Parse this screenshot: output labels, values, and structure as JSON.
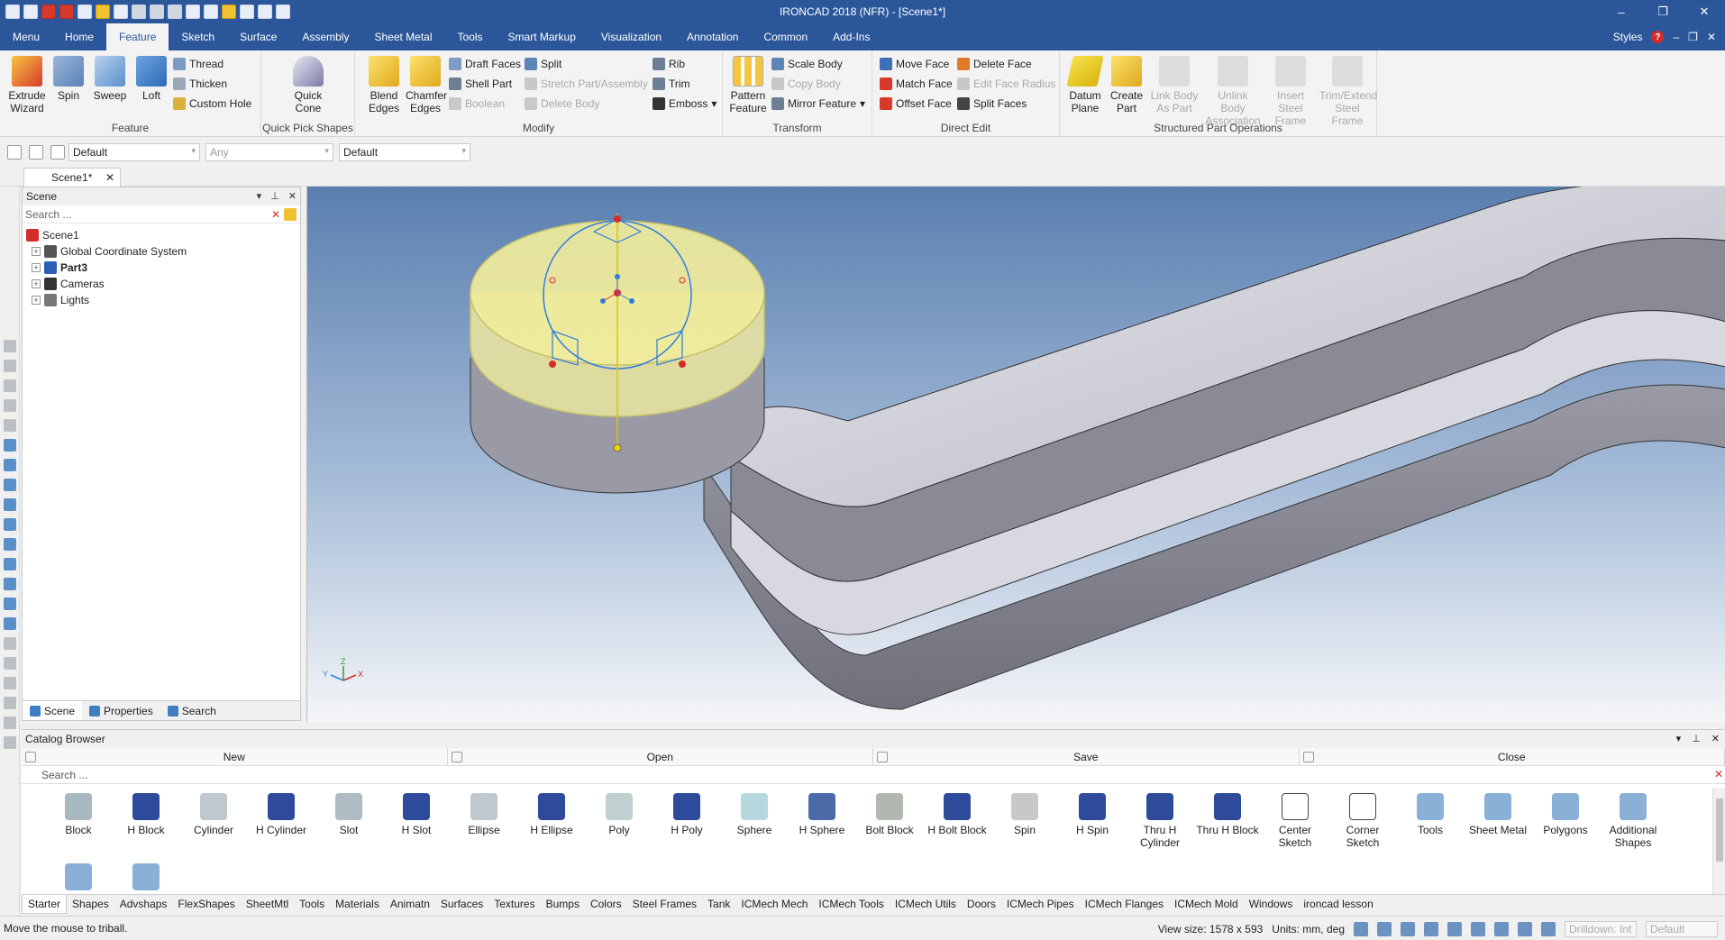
{
  "window": {
    "title": "IRONCAD 2018 (NFR) - [Scene1*]",
    "minimize": "–",
    "restore": "❐",
    "close": "✕"
  },
  "ribbon_tabs": [
    "Menu",
    "Home",
    "Feature",
    "Sketch",
    "Surface",
    "Assembly",
    "Sheet Metal",
    "Tools",
    "Smart Markup",
    "Visualization",
    "Annotation",
    "Common",
    "Add-Ins"
  ],
  "ribbon_right": {
    "styles": "Styles",
    "help": "?"
  },
  "groups": {
    "feature": {
      "label": "Feature",
      "extrude": "Extrude Wizard",
      "spin": "Spin",
      "sweep": "Sweep",
      "loft": "Loft",
      "thread": "Thread",
      "thicken": "Thicken",
      "custom_hole": "Custom Hole"
    },
    "quick_pick": {
      "label": "Quick Pick Shapes",
      "quick_cone": "Quick Cone"
    },
    "modify": {
      "label": "Modify",
      "blend": "Blend Edges",
      "chamfer": "Chamfer Edges",
      "draft_faces": "Draft Faces",
      "shell_part": "Shell Part",
      "boolean": "Boolean",
      "split": "Split",
      "stretch": "Stretch Part/Assembly",
      "delete_body": "Delete Body",
      "rib": "Rib",
      "trim": "Trim",
      "emboss": "Emboss"
    },
    "transform": {
      "label": "Transform",
      "pattern": "Pattern Feature",
      "scale_body": "Scale Body",
      "copy_body": "Copy Body",
      "mirror": "Mirror Feature"
    },
    "direct_edit": {
      "label": "Direct Edit",
      "move_face": "Move Face",
      "match_face": "Match Face",
      "offset_face": "Offset Face",
      "delete_face": "Delete Face",
      "edit_radius": "Edit Face Radius",
      "split_faces": "Split Faces"
    },
    "structured": {
      "label": "Structured Part Operations",
      "datum": "Datum Plane",
      "create_part": "Create Part",
      "link_body": "Link Body As Part",
      "unlink_body": "Unlink Body Association",
      "insert_steel": "Insert Steel Frame",
      "trim_extend": "Trim/Extend Steel Frame"
    }
  },
  "selection_bar": {
    "combo1": "Default",
    "combo2": "Any",
    "combo3": "Default"
  },
  "doc_tab": {
    "label": "Scene1*",
    "close": "✕"
  },
  "scene_panel": {
    "title": "Scene",
    "search_placeholder": "Search ...",
    "tree": [
      "Scene1",
      "Global Coordinate System",
      "Part3",
      "Cameras",
      "Lights"
    ],
    "tabs": [
      "Scene",
      "Properties",
      "Search"
    ]
  },
  "viewport": {
    "axis_x": "X",
    "axis_y": "Y",
    "axis_z": "Z"
  },
  "catalog": {
    "title": "Catalog Browser",
    "actions": [
      "New",
      "Open",
      "Save",
      "Close"
    ],
    "search_placeholder": "Search ...",
    "items": [
      "Block",
      "H Block",
      "Cylinder",
      "H Cylinder",
      "Slot",
      "H Slot",
      "Ellipse",
      "H Ellipse",
      "Poly",
      "H Poly",
      "Sphere",
      "H Sphere",
      "Bolt Block",
      "H Bolt Block",
      "Spin",
      "H Spin",
      "Thru H Cylinder",
      "Thru H Block",
      "Center Sketch",
      "Corner Sketch",
      "Tools",
      "Sheet Metal",
      "Polygons",
      "Additional Shapes"
    ],
    "tabs": [
      "Starter",
      "Shapes",
      "Advshaps",
      "FlexShapes",
      "SheetMtl",
      "Tools",
      "Materials",
      "Animatn",
      "Surfaces",
      "Textures",
      "Bumps",
      "Colors",
      "Steel Frames",
      "Tank",
      "ICMech Mech",
      "ICMech Tools",
      "ICMech Utils",
      "Doors",
      "ICMech  Pipes",
      "ICMech Flanges",
      "ICMech Mold",
      "Windows",
      "ironcad lesson"
    ]
  },
  "status": {
    "message": "Move the mouse to triball.",
    "view_size": "View size: 1578 x 593",
    "units": "Units: mm, deg",
    "drilldown": "Drilldown: Int",
    "default": "Default"
  },
  "colors": {
    "accent": "#2b579a",
    "highlight": "#f0ec9c",
    "part": "#9a9aa6"
  }
}
